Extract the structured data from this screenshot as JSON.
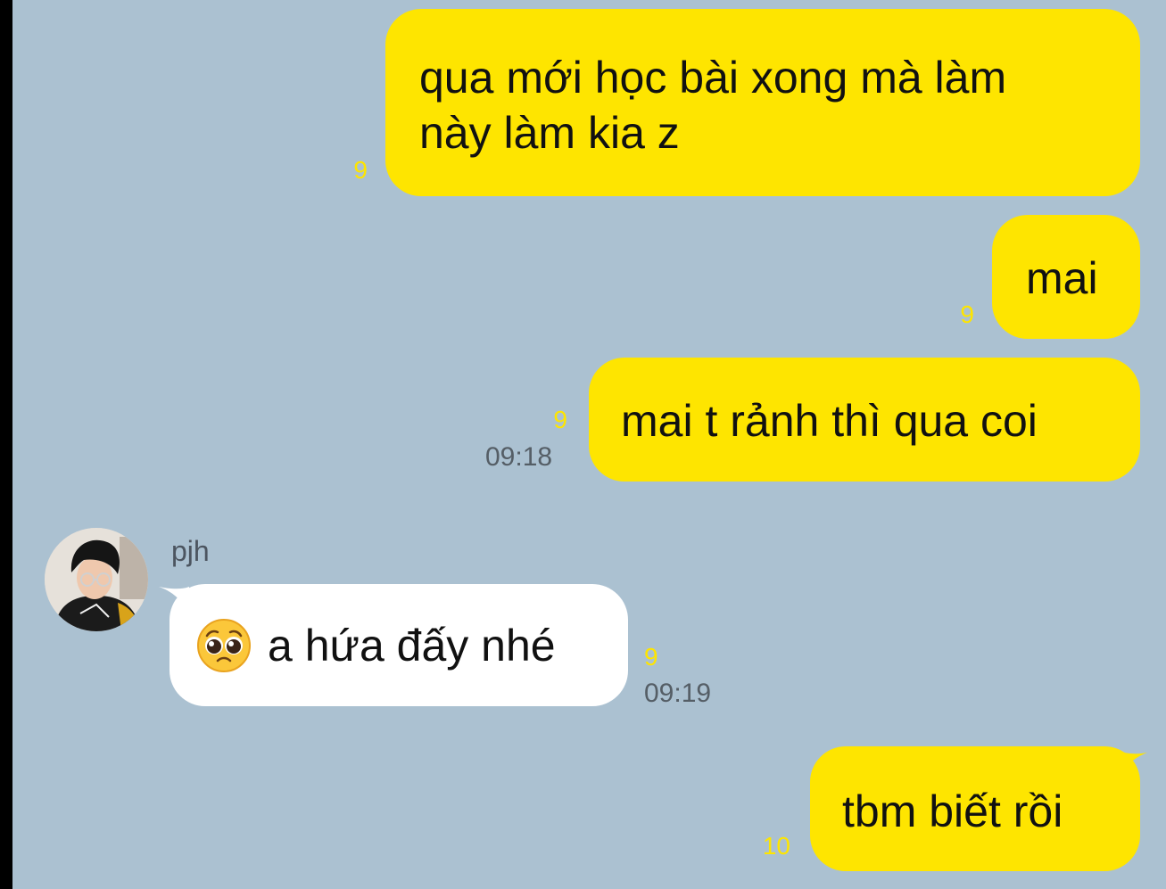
{
  "messages": [
    {
      "side": "sent",
      "text_lines": [
        "qua mới học bài xong mà làm",
        "này làm kia z"
      ],
      "unread": "9"
    },
    {
      "side": "sent",
      "text": "mai",
      "unread": "9"
    },
    {
      "side": "sent",
      "text": "mai t rảnh thì qua coi",
      "unread": "9",
      "time": "09:18"
    },
    {
      "side": "received",
      "sender": "pjh",
      "emoji": "pleading-face",
      "text": "a hứa đấy nhé",
      "unread": "9",
      "time": "09:19"
    },
    {
      "side": "sent",
      "text": "tbm biết rồi",
      "unread": "10"
    }
  ],
  "colors": {
    "background": "#abc1d1",
    "sent_bubble": "#fee500",
    "received_bubble": "#ffffff",
    "unread_count": "#fee500",
    "timestamp": "#555e66"
  }
}
